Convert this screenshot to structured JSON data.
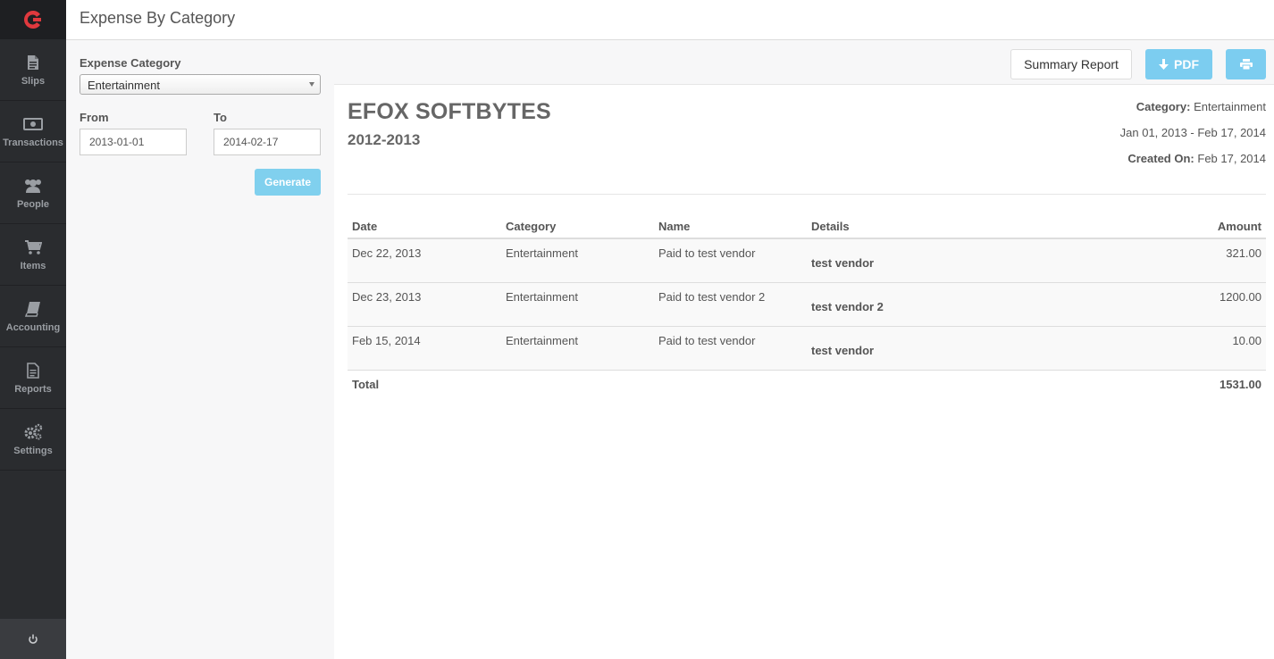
{
  "header": {
    "title": "Expense By Category"
  },
  "sidebar": {
    "items": [
      {
        "label": "Slips",
        "icon": "slips-icon"
      },
      {
        "label": "Transactions",
        "icon": "money-icon"
      },
      {
        "label": "People",
        "icon": "people-icon"
      },
      {
        "label": "Items",
        "icon": "cart-icon"
      },
      {
        "label": "Accounting",
        "icon": "book-icon"
      },
      {
        "label": "Reports",
        "icon": "report-icon"
      },
      {
        "label": "Settings",
        "icon": "gears-icon"
      }
    ]
  },
  "filter": {
    "category_label": "Expense Category",
    "category_value": "Entertainment",
    "from_label": "From",
    "from_value": "2013-01-01",
    "to_label": "To",
    "to_value": "2014-02-17",
    "generate_label": "Generate"
  },
  "toolbar": {
    "summary_label": "Summary Report",
    "pdf_label": "PDF"
  },
  "report": {
    "company": "EFOX SOFTBYTES",
    "period": "2012-2013",
    "category_key": "Category:",
    "category_value": "Entertainment",
    "date_range": "Jan 01, 2013 - Feb 17, 2014",
    "created_key": "Created On:",
    "created_value": "Feb 17, 2014",
    "columns": [
      "Date",
      "Category",
      "Name",
      "Details",
      "Amount"
    ],
    "rows": [
      {
        "date": "Dec 22, 2013",
        "category": "Entertainment",
        "name": "Paid to test vendor",
        "details": "test vendor",
        "amount": "321.00"
      },
      {
        "date": "Dec 23, 2013",
        "category": "Entertainment",
        "name": "Paid to test vendor 2",
        "details": "test vendor 2",
        "amount": "1200.00"
      },
      {
        "date": "Feb 15, 2014",
        "category": "Entertainment",
        "name": "Paid to test vendor",
        "details": "test vendor",
        "amount": "10.00"
      }
    ],
    "total_label": "Total",
    "total_value": "1531.00"
  },
  "colors": {
    "accent": "#7ccdf0",
    "brand": "#e0393e",
    "sidebar": "#2a2c2f"
  }
}
